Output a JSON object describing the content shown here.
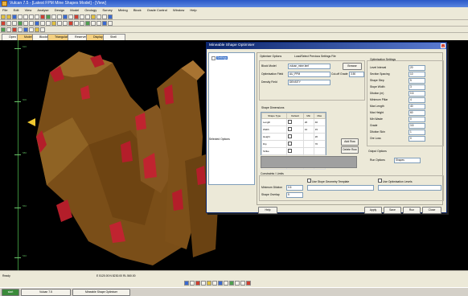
{
  "window": {
    "title": "Vulcan 7.5 - [Latest FPM Mine Shapes Model] - [View]"
  },
  "menu": [
    "File",
    "Edit",
    "View",
    "Analyse",
    "Design",
    "Model",
    "Geology",
    "Survey",
    "Mining",
    "Block",
    "Grade Control",
    "Window",
    "Help"
  ],
  "view_tabs": [
    "Open",
    "Model",
    "Blocks",
    "Triangulate",
    "Reserves",
    "Display",
    "Shell"
  ],
  "axis_labels": [
    "620",
    "600",
    "580",
    "560",
    "540"
  ],
  "dialog": {
    "title": "Mineable Shape Optimiser",
    "close": "×",
    "tree_item": "Settings",
    "tree_footer": "Selected Options",
    "header_label": "Optimiser Options",
    "header_value": "Load/Select Previous Settings File",
    "block_model_label": "Block Model",
    "block_model_value": "vulcan_mine.bmf",
    "browse": "Browse",
    "optimisation_field_label": "Optimisation Field",
    "optimisation_field_value": "AU_PPM",
    "density_label": "Density Field",
    "density_value": "DENSITY",
    "cutoff_label": "Cut-off Grade",
    "cutoff_value": "3.50",
    "dimension_label": "Shape Dimensions",
    "grid_headers": [
      "Shape Type",
      "Default",
      "Min",
      "Max"
    ],
    "grid_rows": [
      [
        "Length",
        "1",
        "20",
        "40"
      ],
      [
        "Width",
        "1",
        "10",
        "15"
      ],
      [
        "Height",
        "",
        "",
        "20"
      ],
      [
        "Dip",
        "",
        "",
        "70"
      ],
      [
        "Strike",
        "",
        "",
        ""
      ],
      [
        "Offset",
        "",
        "",
        "5"
      ],
      [
        "Ramp",
        "",
        "",
        ""
      ]
    ],
    "add_button": "Add Row",
    "delete_button": "Delete Row",
    "constraints_label": "Constraints / Limits",
    "dilution_label": "Minimum Dilution",
    "dilution_value": "0.5",
    "overlap_label": "Shape Overlap",
    "overlap_value": "5",
    "check_a": "Use Stope Geometry Template",
    "check_b": "Use Optimisation Levels",
    "right_group": "Optimisation Settings",
    "right_labels": [
      "Level Interval",
      "Section Spacing",
      "Shape Step",
      "Stope Width",
      "Dilution (m)",
      "Minimum Pillar",
      "Max Length",
      "Max Height",
      "Min Waste",
      "Grade",
      "Dilution Skin",
      "Ore Loss"
    ],
    "right_values": [
      "20",
      "10",
      "5",
      "3",
      "0.5",
      "4",
      "40",
      "60",
      "0",
      "3.5",
      "1",
      "0"
    ],
    "output_label": "Output Options",
    "output_value": "Shapes",
    "run_label": "Run Options",
    "footer_buttons": [
      "Apply",
      "Save",
      "Run",
      "Close"
    ],
    "help_button": "Help"
  },
  "status": {
    "text": "Ready",
    "coords": "E 5120.00 N 8230.00 RL 560.00"
  },
  "taskbar": {
    "start": "start",
    "tasks": [
      "Vulcan 7.5",
      "Mineable Shape Optimiser"
    ]
  },
  "colors": {
    "ore": "#8a5a1c",
    "high_grade": "#b41e2a",
    "background": "#000000"
  }
}
